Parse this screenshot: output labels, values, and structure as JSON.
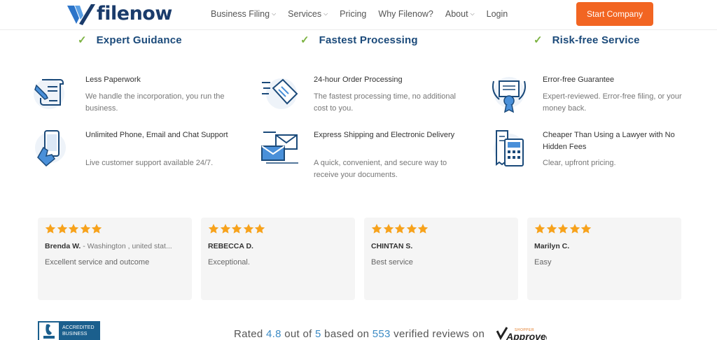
{
  "brand": {
    "name": "filenow"
  },
  "nav": {
    "items": [
      {
        "label": "Business Filing",
        "dropdown": true
      },
      {
        "label": "Services",
        "dropdown": true
      },
      {
        "label": "Pricing",
        "dropdown": false
      },
      {
        "label": "Why Filenow?",
        "dropdown": false
      },
      {
        "label": "About",
        "dropdown": true
      },
      {
        "label": "Login",
        "dropdown": false
      }
    ],
    "cta": "Start Company"
  },
  "columns": [
    {
      "heading": "Expert Guidance",
      "features": [
        {
          "icon": "paperwork-icon",
          "title": "Less Paperwork",
          "desc": "We handle the incorporation, you run the business."
        },
        {
          "icon": "phone-icon",
          "title": "Unlimited Phone, Email and Chat Support",
          "desc": "Live customer support available 24/7."
        }
      ]
    },
    {
      "heading": "Fastest Processing",
      "features": [
        {
          "icon": "fast-document-icon",
          "title": "24-hour Order Processing",
          "desc": "The fastest processing time, no additional cost to you."
        },
        {
          "icon": "envelopes-icon",
          "title": "Express Shipping and Electronic Delivery",
          "desc": "A quick, convenient, and secure way to receive your documents."
        }
      ]
    },
    {
      "heading": "Risk-free Service",
      "features": [
        {
          "icon": "certificate-award-icon",
          "title": "Error-free Guarantee",
          "desc": "Expert-reviewed. Error-free filing, or your money back."
        },
        {
          "icon": "receipt-calculator-icon",
          "title": "Cheaper Than Using a Lawyer with No Hidden Fees",
          "desc": "Clear, upfront pricing."
        }
      ]
    }
  ],
  "reviews": [
    {
      "name": "Brenda W.",
      "location": "- Washington , united stat...",
      "text": "Excellent service and outcome",
      "stars": 5
    },
    {
      "name": "REBECCA D.",
      "location": "",
      "text": "Exceptional.",
      "stars": 5
    },
    {
      "name": "CHINTAN S.",
      "location": "",
      "text": "Best service",
      "stars": 5
    },
    {
      "name": "Marilyn C.",
      "location": "",
      "text": "Easy",
      "stars": 5
    }
  ],
  "rating": {
    "prefix": "Rated",
    "score": "4.8",
    "out_of_label": "out of",
    "max": "5",
    "based_on_label": "based on",
    "count": "553",
    "suffix": "verified reviews on"
  },
  "badges": {
    "bbb_line1": "ACCREDITED",
    "bbb_line2": "BUSINESS",
    "shopper_small": "SHOPPER",
    "shopper_big": "Approved"
  },
  "colors": {
    "accent": "#f26522",
    "heading": "#1b4a7a",
    "check": "#7cb342",
    "star": "#f7a21b",
    "link_number": "#3c8bc5"
  }
}
